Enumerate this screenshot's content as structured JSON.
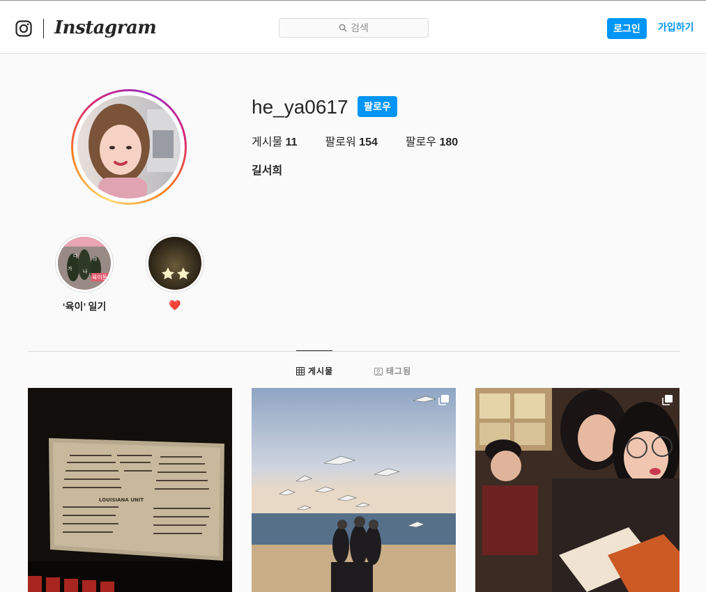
{
  "header": {
    "logo_text": "Instagram",
    "search_placeholder": "검색",
    "login_label": "로그인",
    "signup_label": "가입하기",
    "icons": [
      "instagram-glyph-icon",
      "search-icon"
    ]
  },
  "profile": {
    "username": "he_ya0617",
    "follow_label": "팔로우",
    "stats": [
      {
        "label": "게시물",
        "value": "11"
      },
      {
        "label": "팔로워",
        "value": "154"
      },
      {
        "label": "팔로우",
        "value": "180"
      }
    ],
    "full_name": "길서희"
  },
  "highlights": [
    {
      "label": "‘육이’ 일기",
      "photo_text": [
        "다",
        "라",
        "가",
        "나",
        "육이툰"
      ]
    },
    {
      "label": "❤️"
    }
  ],
  "tabs": [
    {
      "label": "게시물",
      "icon": "grid-icon",
      "active": true
    },
    {
      "label": "태그됨",
      "icon": "tagged-icon",
      "active": false
    }
  ],
  "posts": [
    {
      "description": "movie theater credits",
      "credits_heading": "LOUISIANA UNIT",
      "multiple": false
    },
    {
      "description": "seagulls at the beach",
      "multiple": true
    },
    {
      "description": "two friends selfie at a restaurant",
      "multiple": true
    }
  ],
  "colors": {
    "accent": "#0095f6",
    "text": "#262626",
    "muted": "#8e8e8e",
    "border": "#dbdbdb",
    "background": "#fafafa"
  }
}
